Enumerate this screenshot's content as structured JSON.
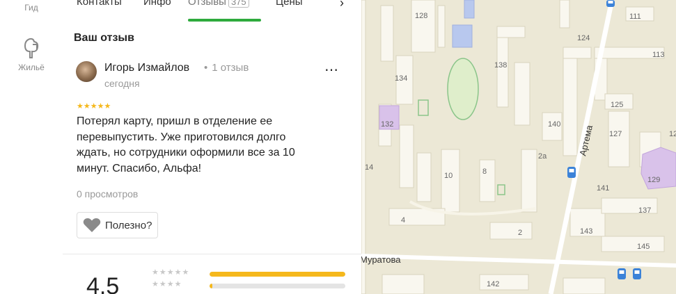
{
  "left_rail": {
    "guide_label": "Гид",
    "housing_label": "Жильё"
  },
  "tabs": [
    {
      "label": "Контакты"
    },
    {
      "label": "Инфо"
    },
    {
      "label": "Отзывы",
      "badge": "375",
      "active": true
    },
    {
      "label": "Цены"
    }
  ],
  "section": {
    "title": "Ваш отзыв"
  },
  "review": {
    "author": "Игорь Измайлов",
    "review_count": "1 отзыв",
    "date": "сегодня",
    "stars": "★★★★★",
    "text": "Потерял карту, пришл в отделение ее перевыпустить. Уже приготовился долго ждать, но сотрудники оформили все за 10 минут. Спасибо, Альфа!",
    "views": "0 просмотров",
    "helpful_label": "Полезно?",
    "more_label": "⋯"
  },
  "rating_summary": {
    "average": "4.5",
    "rows": [
      {
        "stars": "★★★★★",
        "fraction": 1.0
      },
      {
        "stars": "★★★★",
        "fraction": 0.02
      }
    ]
  },
  "map": {
    "street": "Муратова",
    "avenue": "Артема",
    "building_numbers": [
      "128",
      "111",
      "124",
      "113",
      "138",
      "134",
      "125",
      "132",
      "140",
      "127",
      "12",
      "2а",
      "14",
      "10",
      "8",
      "141",
      "129",
      "137",
      "4",
      "143",
      "2",
      "145",
      "142"
    ]
  },
  "colors": {
    "accent_green": "#2eaa3d",
    "star_yellow": "#f5b81c",
    "map_background": "#ece8d6",
    "map_building": "#f9f7ef",
    "bus_stop": "#3b82d8"
  }
}
